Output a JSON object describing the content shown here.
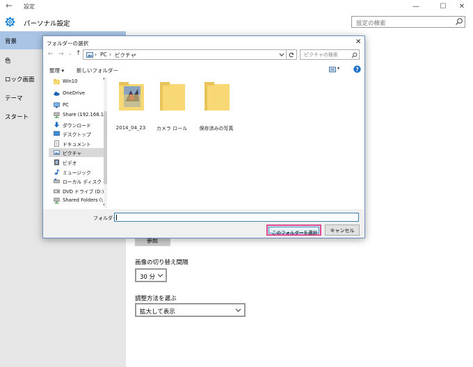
{
  "settings": {
    "window_title": "設定",
    "header_title": "パーソナル設定",
    "search_placeholder": "設定の検索",
    "sidebar": [
      {
        "label": "背景"
      },
      {
        "label": "色"
      },
      {
        "label": "ロック画面"
      },
      {
        "label": "テーマ"
      },
      {
        "label": "スタート"
      }
    ],
    "browse_label": "参照",
    "interval_label": "画像の切り替え間隔",
    "interval_value": "30 分",
    "fit_label": "調整方法を選ぶ",
    "fit_value": "拡大して表示"
  },
  "dialog": {
    "title": "フォルダーの選択",
    "breadcrumb": [
      "PC",
      "ピクチャ"
    ],
    "search_placeholder": "ピクチャの検索",
    "organize_label": "整理 ▾",
    "new_folder_label": "新しいフォルダー",
    "nav_items": [
      {
        "label": "Win10",
        "icon": "folder-icon"
      },
      {
        "label": "OneDrive",
        "icon": "onedrive-icon"
      },
      {
        "label": "PC",
        "icon": "pc-icon"
      },
      {
        "label": "Share (192.168.1.",
        "icon": "network-drive-icon"
      },
      {
        "label": "ダウンロード",
        "icon": "download-icon"
      },
      {
        "label": "デスクトップ",
        "icon": "desktop-icon"
      },
      {
        "label": "ドキュメント",
        "icon": "document-icon"
      },
      {
        "label": "ピクチャ",
        "icon": "pictures-icon"
      },
      {
        "label": "ビデオ",
        "icon": "video-icon"
      },
      {
        "label": "ミュージック",
        "icon": "music-icon"
      },
      {
        "label": "ローカル ディスク (C",
        "icon": "disk-icon"
      },
      {
        "label": "DVD ドライブ (D:)",
        "icon": "dvd-icon"
      },
      {
        "label": "Shared Folders (\\",
        "icon": "shared-folder-icon"
      }
    ],
    "files": [
      {
        "name": "2014_04_23"
      },
      {
        "name": "カメラ ロール"
      },
      {
        "name": "保存済みの写真"
      }
    ],
    "folder_field_label": "フォルダー:",
    "folder_field_value": "",
    "select_label": "このフォルダーを選択",
    "cancel_label": "キャンセル"
  },
  "colors": {
    "sidebar_active": "#a9c4e4",
    "sidebar_bg": "#e6e6e6",
    "accent_blue": "#0078d7",
    "highlight_pink": "#d9458f",
    "folder_yellow": "#f8d775"
  }
}
